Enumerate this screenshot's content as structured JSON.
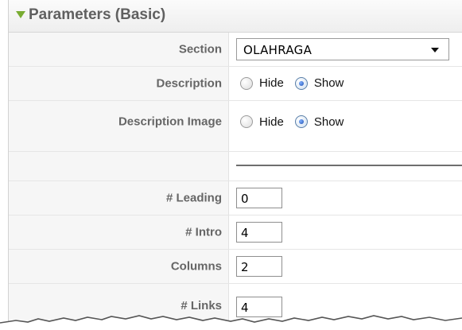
{
  "header": {
    "title": "Parameters (Basic)"
  },
  "rows": [
    {
      "label": "Section",
      "select_value": "OLAHRAGA"
    },
    {
      "label": "Description",
      "options": [
        "Hide",
        "Show"
      ],
      "selected": "Show"
    },
    {
      "label": "Description Image",
      "options": [
        "Hide",
        "Show"
      ],
      "selected": "Show"
    },
    {
      "label": ""
    },
    {
      "label": "# Leading",
      "value": "0"
    },
    {
      "label": "# Intro",
      "value": "4"
    },
    {
      "label": "Columns",
      "value": "2"
    },
    {
      "label": "# Links",
      "value": "4"
    }
  ],
  "colors": {
    "accent_triangle": "#79ac32",
    "label_bg": "#f6f6f6",
    "label_text": "#666666"
  }
}
